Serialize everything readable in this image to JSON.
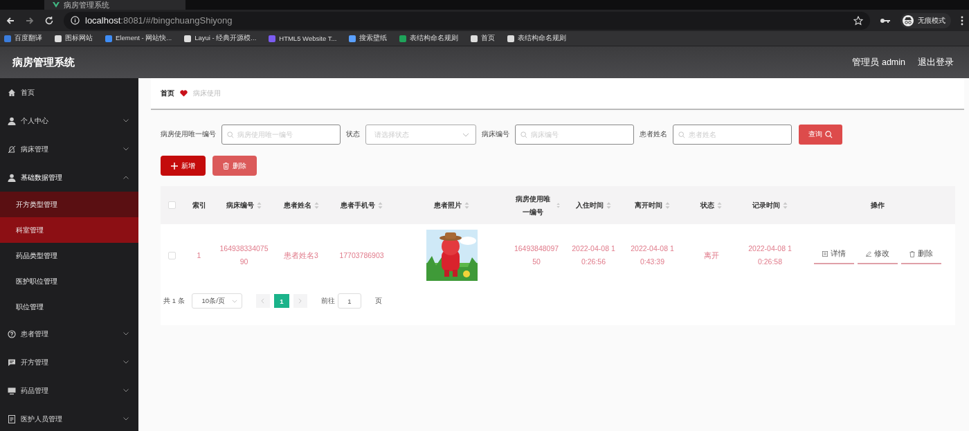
{
  "browser": {
    "tab_title": "病房管理系统",
    "url_host": "localhost",
    "url_path": ":8081/#/bingchuangShiyong",
    "profile_label": "无痕模式",
    "bookmarks": [
      {
        "label": "百度翻译"
      },
      {
        "label": "图标网站"
      },
      {
        "label": "Element - 网站快..."
      },
      {
        "label": "Layui - 经典开源模..."
      },
      {
        "label": "HTML5 Website T..."
      },
      {
        "label": "搜索壁纸"
      },
      {
        "label": "表结构命名规则"
      },
      {
        "label": "首页"
      },
      {
        "label": "表结构命名规则"
      }
    ]
  },
  "header": {
    "title": "病房管理系统",
    "user": "管理员 admin",
    "logout": "退出登录"
  },
  "sidebar": {
    "items": [
      {
        "label": "首页"
      },
      {
        "label": "个人中心",
        "expanded": false
      },
      {
        "label": "病床管理",
        "expanded": false
      },
      {
        "label": "基础数据管理",
        "expanded": true,
        "children": [
          {
            "label": "开方类型管理",
            "selected": false,
            "hovered": true
          },
          {
            "label": "科室管理",
            "selected": true,
            "hovered": false
          },
          {
            "label": "药品类型管理",
            "selected": false,
            "hovered": false
          },
          {
            "label": "医护职位管理",
            "selected": false,
            "hovered": false
          },
          {
            "label": "职位管理",
            "selected": false,
            "hovered": false
          }
        ]
      },
      {
        "label": "患者管理",
        "expanded": false
      },
      {
        "label": "开方管理",
        "expanded": false
      },
      {
        "label": "药品管理",
        "expanded": false
      },
      {
        "label": "医护人员管理",
        "expanded": false
      }
    ]
  },
  "breadcrumb": [
    {
      "label": "首页",
      "current": false
    },
    {
      "label": "病床使用",
      "current": true
    }
  ],
  "filters": [
    {
      "label": "病房使用唯一编号",
      "placeholder": "病房使用唯一编号",
      "kind": "input"
    },
    {
      "label": "状态",
      "placeholder": "请选择状态",
      "kind": "select"
    },
    {
      "label": "病床编号",
      "placeholder": "病床编号",
      "kind": "input"
    },
    {
      "label": "患者姓名",
      "placeholder": "患者姓名",
      "kind": "input"
    }
  ],
  "search_button": "查询",
  "actions": [
    {
      "label": "新增",
      "kind": "add"
    },
    {
      "label": "删除",
      "kind": "delete"
    }
  ],
  "table": {
    "select_all_checked": false,
    "columns": [
      {
        "label": "索引",
        "sortable": false
      },
      {
        "label": "病床编号",
        "sortable": true
      },
      {
        "label": "患者姓名",
        "sortable": true
      },
      {
        "label": "患者手机号",
        "sortable": true
      },
      {
        "label": "患者照片",
        "sortable": true
      },
      {
        "label": "病房使用唯一编号",
        "sortable": true
      },
      {
        "label": "入住时间",
        "sortable": true
      },
      {
        "label": "离开时间",
        "sortable": true
      },
      {
        "label": "状态",
        "sortable": true
      },
      {
        "label": "记录时间",
        "sortable": true
      },
      {
        "label": "操作",
        "sortable": false
      }
    ],
    "rows": [
      {
        "checked": false,
        "cells": [
          {
            "kind": "text",
            "text": "1"
          },
          {
            "kind": "text",
            "text": "164938334075 90"
          },
          {
            "kind": "text",
            "text": "患者姓名3"
          },
          {
            "kind": "text",
            "text": "17703786903"
          },
          {
            "kind": "picture"
          },
          {
            "kind": "text",
            "text": "16493848097 50"
          },
          {
            "kind": "text",
            "text": "2022-04-08 1 0:26:56"
          },
          {
            "kind": "text",
            "text": "2022-04-08 1 0:43:39"
          },
          {
            "kind": "text",
            "text": "离开"
          },
          {
            "kind": "text",
            "text": "2022-04-08 1 0:26:58"
          },
          {
            "kind": "actions",
            "actions": [
              {
                "label": "详情",
                "kind": "detail"
              },
              {
                "label": "修改",
                "kind": "edit"
              },
              {
                "label": "删除",
                "kind": "delete"
              }
            ]
          }
        ]
      }
    ]
  },
  "pagination": {
    "total": "共 1 条",
    "page_size": "10条/页",
    "pages": [
      {
        "label": "1",
        "selected": true
      }
    ],
    "goto_label": "前往",
    "goto_value": "1",
    "goto_suffix": "页"
  }
}
